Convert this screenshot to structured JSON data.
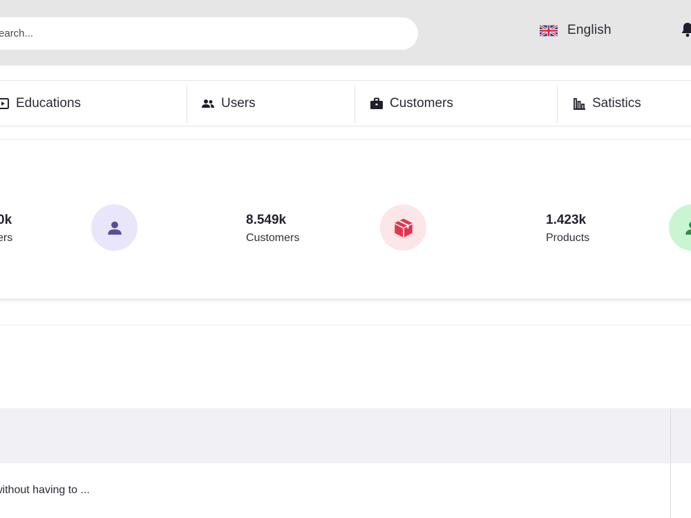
{
  "header": {
    "search": {
      "placeholder": "Search...",
      "value": ""
    },
    "language": {
      "label": "English",
      "flag_icon": "uk-flag-icon"
    },
    "notifications_icon": "bell-icon"
  },
  "nav": {
    "tabs": [
      {
        "label": "Educations",
        "icon": "video-icon"
      },
      {
        "label": "Users",
        "icon": "users-icon"
      },
      {
        "label": "Customers",
        "icon": "briefcase-icon"
      },
      {
        "label": "Satistics",
        "icon": "bar-chart-icon"
      }
    ]
  },
  "stats": {
    "items": [
      {
        "value": "0k",
        "label": "ers",
        "icon": "user-icon",
        "icon_bg": "#e9e5fa",
        "icon_color": "#5a4a9c"
      },
      {
        "value": "8.549k",
        "label": "Customers",
        "icon": "box-icon",
        "icon_bg": "#fde6e8",
        "icon_color": "#e0364f"
      },
      {
        "value": "1.423k",
        "label": "Products",
        "icon": "user-icon",
        "icon_bg": "#c9f5d3",
        "icon_color": "#2d8a4a"
      }
    ]
  },
  "table": {
    "rows": [
      {
        "text": "without having to ..."
      }
    ]
  }
}
